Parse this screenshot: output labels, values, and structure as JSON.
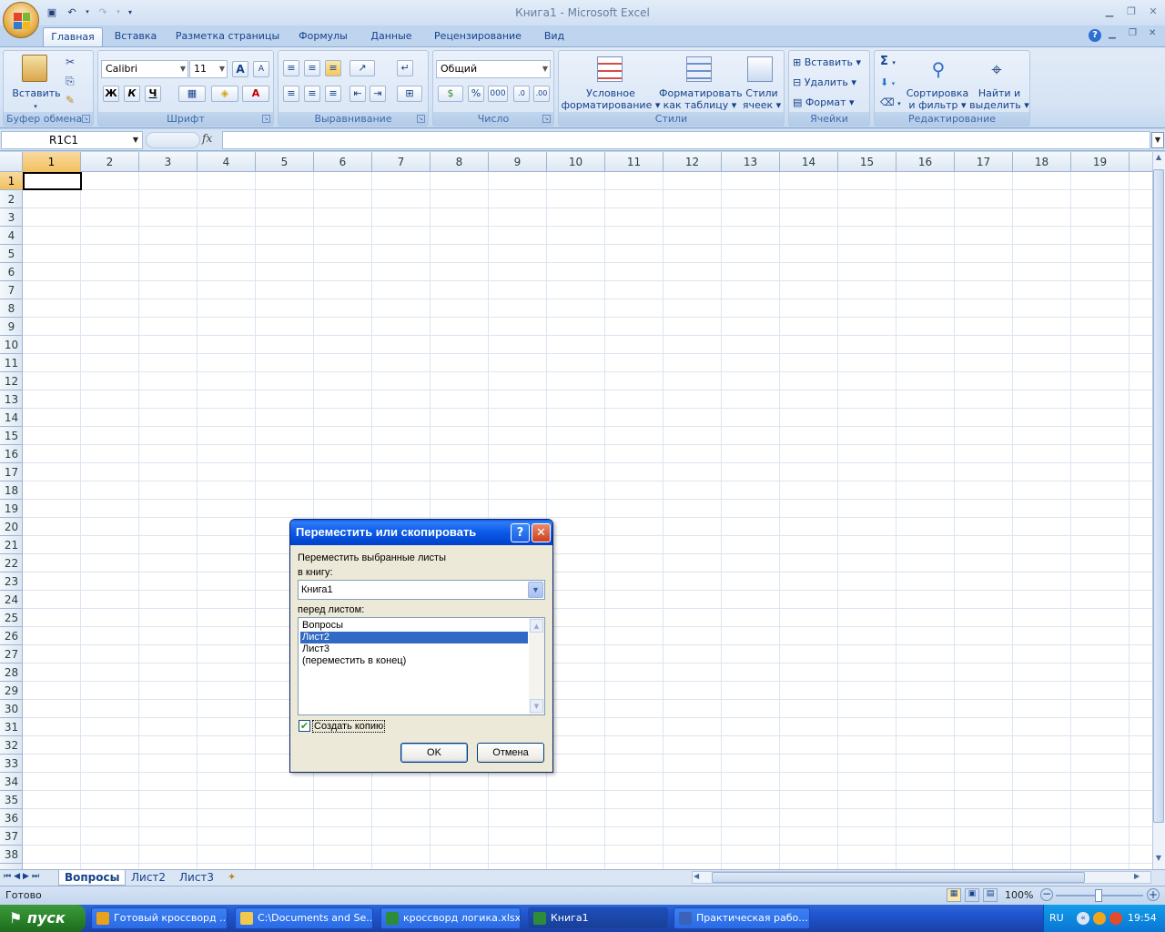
{
  "window": {
    "title": "Книга1 - Microsoft Excel"
  },
  "ribbon_tabs": [
    "Главная",
    "Вставка",
    "Разметка страницы",
    "Формулы",
    "Данные",
    "Рецензирование",
    "Вид"
  ],
  "ribbon": {
    "clipboard": {
      "label": "Буфер обмена",
      "paste": "Вставить"
    },
    "font": {
      "label": "Шрифт",
      "name": "Calibri",
      "size": "11",
      "bold": "Ж",
      "italic": "К",
      "underline": "Ч",
      "grow": "A",
      "shrink": "A"
    },
    "alignment": {
      "label": "Выравнивание"
    },
    "number": {
      "label": "Число",
      "format": "Общий",
      "percent": "%",
      "thousands": "000"
    },
    "styles": {
      "label": "Стили",
      "cond_line1": "Условное",
      "cond_line2": "форматирование",
      "table_line1": "Форматировать",
      "table_line2": "как таблицу",
      "cell_line1": "Стили",
      "cell_line2": "ячеек"
    },
    "cells": {
      "label": "Ячейки",
      "insert": "Вставить",
      "delete": "Удалить",
      "format": "Формат"
    },
    "editing": {
      "label": "Редактирование",
      "sigma": "Σ",
      "sort_line1": "Сортировка",
      "sort_line2": "и фильтр",
      "find_line1": "Найти и",
      "find_line2": "выделить"
    }
  },
  "formula_bar": {
    "name_box": "R1C1",
    "fx": "fx",
    "value": ""
  },
  "grid": {
    "columns": [
      "1",
      "2",
      "3",
      "4",
      "5",
      "6",
      "7",
      "8",
      "9",
      "10",
      "11",
      "12",
      "13",
      "14",
      "15",
      "16",
      "17",
      "18",
      "19"
    ],
    "rows": [
      "1",
      "2",
      "3",
      "4",
      "5",
      "6",
      "7",
      "8",
      "9",
      "10",
      "11",
      "12",
      "13",
      "14",
      "15",
      "16",
      "17",
      "18",
      "19",
      "20",
      "21",
      "22",
      "23",
      "24",
      "25",
      "26",
      "27",
      "28",
      "29",
      "30",
      "31",
      "32",
      "33",
      "34",
      "35",
      "36",
      "37",
      "38"
    ],
    "selected_column": "1",
    "selected_row": "1"
  },
  "sheet_tabs": [
    {
      "name": "Вопросы",
      "active": true
    },
    {
      "name": "Лист2",
      "active": false
    },
    {
      "name": "Лист3",
      "active": false
    }
  ],
  "status": {
    "ready": "Готово",
    "zoom": "100%"
  },
  "dialog": {
    "title": "Переместить или скопировать",
    "help": "?",
    "close": "✕",
    "label_move": "Переместить выбранные листы",
    "label_book": "в книгу:",
    "book_value": "Книга1",
    "label_before": "перед листом:",
    "sheet_list": [
      "Вопросы",
      "Лист2",
      "Лист3",
      "(переместить в конец)"
    ],
    "selected_index": 1,
    "checkbox_label": "Создать копию",
    "checkbox_checked": true,
    "ok": "OK",
    "cancel": "Отмена"
  },
  "taskbar": {
    "start": "пуск",
    "tasks": [
      {
        "label": "Готовый кроссворд ...",
        "active": false,
        "icon_color": "#e8a21c"
      },
      {
        "label": "C:\\Documents and Se...",
        "active": false,
        "icon_color": "#f2c94c"
      },
      {
        "label": "кроссворд логика.xlsx",
        "active": false,
        "icon_color": "#2e8b3a"
      },
      {
        "label": "Книга1",
        "active": true,
        "icon_color": "#2e8b3a"
      },
      {
        "label": "Практическая рабо...",
        "active": false,
        "icon_color": "#3a62b8"
      }
    ],
    "lang": "RU",
    "clock": "19:54"
  }
}
